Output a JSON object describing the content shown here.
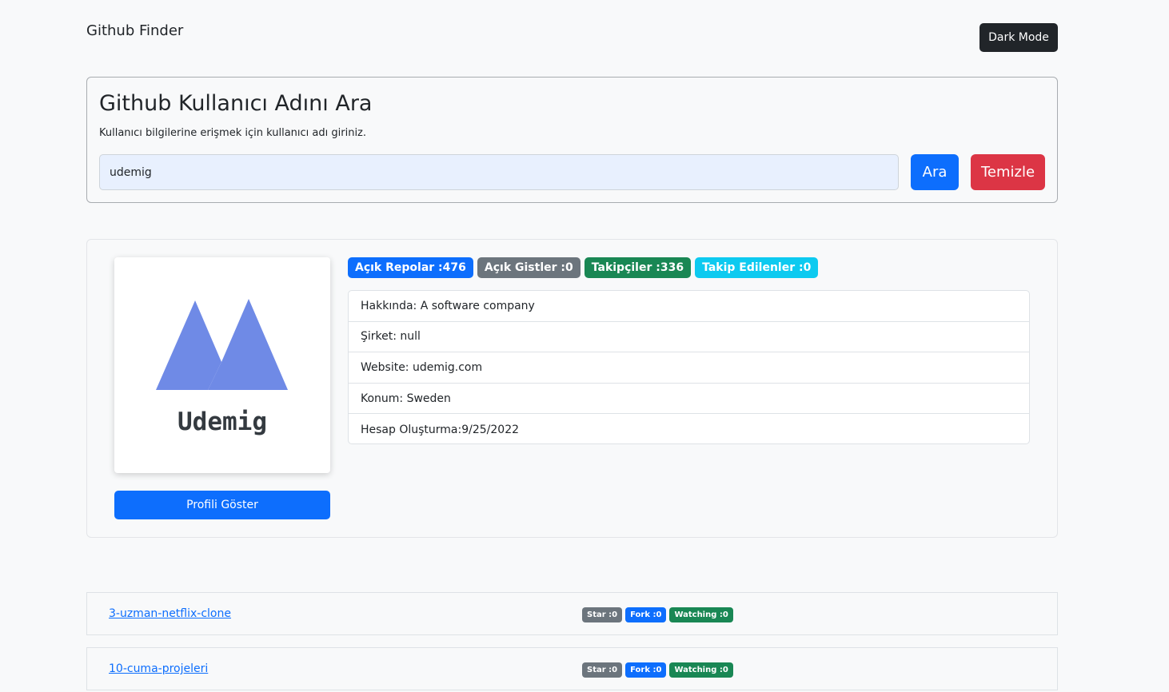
{
  "navbar": {
    "brand": "Github Finder",
    "dark_mode_label": "Dark Mode"
  },
  "search": {
    "title": "Github Kullanıcı Adını Ara",
    "subtitle": "Kullanıcı bilgilerine erişmek için kullanıcı adı giriniz.",
    "input_value": "udemig",
    "search_label": "Ara",
    "clear_label": "Temizle"
  },
  "profile": {
    "avatar_text": "Udemig",
    "show_profile_label": "Profili Göster",
    "badges": [
      "Açık Repolar :476",
      "Açık Gistler :0",
      "Takipçiler :336",
      "Takip Edilenler :0"
    ],
    "details": [
      "Hakkında: A software company",
      "Şirket: null",
      "Website: udemig.com",
      "Konum: Sweden",
      "Hesap Oluşturma:9/25/2022"
    ]
  },
  "repos": [
    {
      "name": "3-uzman-netflix-clone",
      "star": "Star :0",
      "fork": "Fork :0",
      "watching": "Watching :0"
    },
    {
      "name": "10-cuma-projeleri",
      "star": "Star :0",
      "fork": "Fork :0",
      "watching": "Watching :0"
    }
  ],
  "colors": {
    "primary": "#0d6efd",
    "secondary": "#6c757d",
    "success": "#198754",
    "info": "#0dcaf0",
    "danger": "#dc3545",
    "dark": "#212529",
    "logo": "#6f8ae6"
  }
}
